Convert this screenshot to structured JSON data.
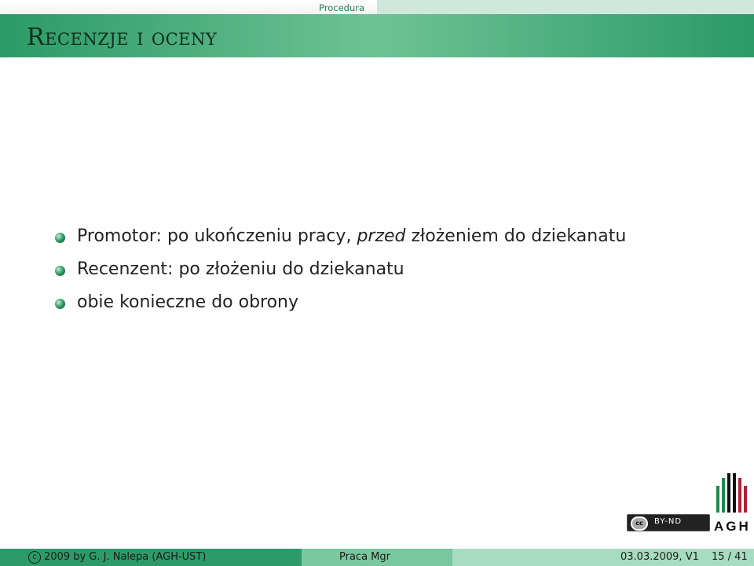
{
  "header": {
    "nav_item": "Procedura",
    "title": "Recenzje i oceny"
  },
  "bullets": [
    {
      "before": "Promotor: po ukończeniu pracy, ",
      "emph": "przed",
      "after": " złożeniem do dziekanatu"
    },
    {
      "before": "Recenzent: po złożeniu do dziekanatu",
      "emph": "",
      "after": ""
    },
    {
      "before": "obie konieczne do obrony",
      "emph": "",
      "after": ""
    }
  ],
  "license": {
    "cc_label": "cc",
    "terms": "BY-ND"
  },
  "logo": {
    "text": "AGH"
  },
  "footer": {
    "copyright_symbol": "c",
    "author": "2009 by G. J. Nalepa  (AGH-UST)",
    "title": "Praca Mgr",
    "date": "03.03.2009, V1",
    "page": "15 / 41"
  },
  "colors": {
    "accent": "#2d9b69",
    "light_accent": "#a6dcc1",
    "bullet": "#35a06a"
  }
}
